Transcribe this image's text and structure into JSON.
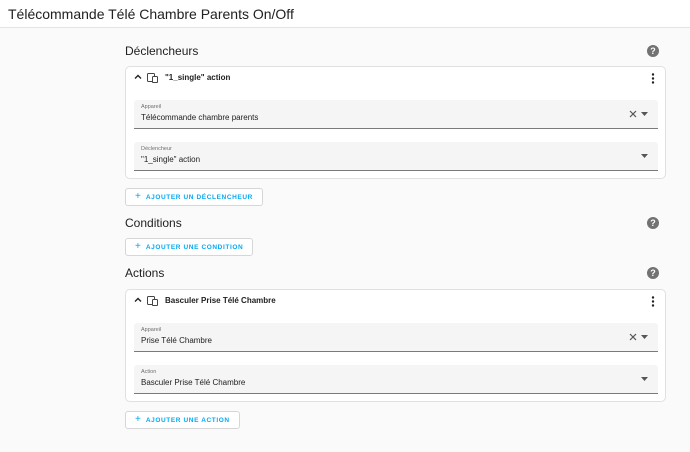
{
  "window": {
    "title": "Télécommande Télé Chambre Parents On/Off"
  },
  "triggers": {
    "heading": "Déclencheurs",
    "card": {
      "title": "\"1_single\" action",
      "device_field": {
        "label": "Appareil",
        "value": "Télécommande chambre parents"
      },
      "trigger_field": {
        "label": "Déclencheur",
        "value": "\"1_single\" action"
      }
    },
    "add_label": "AJOUTER UN DÉCLENCHEUR"
  },
  "conditions": {
    "heading": "Conditions",
    "add_label": "AJOUTER UNE CONDITION"
  },
  "actions": {
    "heading": "Actions",
    "card": {
      "title": "Basculer Prise Télé Chambre",
      "device_field": {
        "label": "Appareil",
        "value": "Prise Télé Chambre"
      },
      "action_field": {
        "label": "Action",
        "value": "Basculer Prise Télé Chambre"
      }
    },
    "add_label": "AJOUTER UNE ACTION"
  },
  "colors": {
    "accent": "#03a9f4",
    "help_icon": "#727272",
    "field_bg": "#f5f5f5"
  },
  "icons": [
    "chevron-up-icon",
    "device-icon",
    "more-vert-icon",
    "help-icon",
    "clear-icon",
    "dropdown-arrow-icon",
    "plus-icon"
  ]
}
